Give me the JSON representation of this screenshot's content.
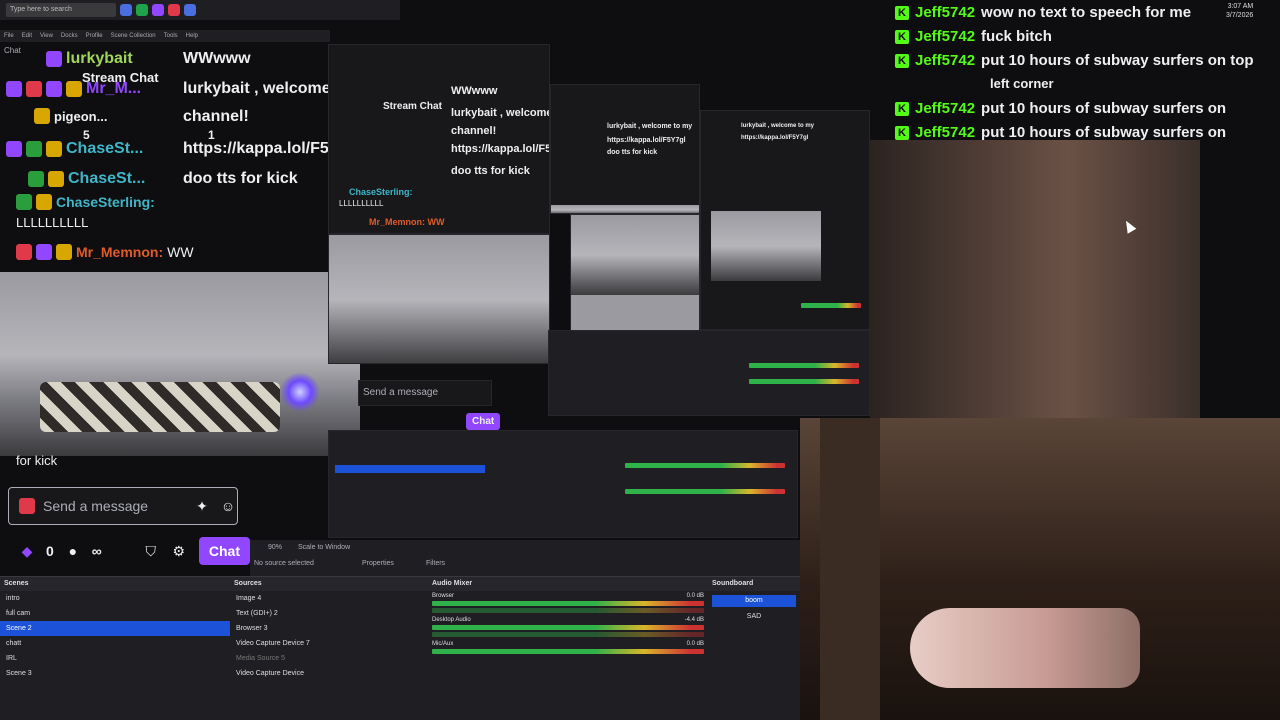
{
  "taskbar": {
    "search_placeholder": "Type here to search"
  },
  "menubar": [
    "File",
    "Edit",
    "View",
    "Docks",
    "Profile",
    "Scene Collection",
    "Tools",
    "Help"
  ],
  "chat_panel": {
    "header": "Chat",
    "stream_title": "Stream Chat",
    "lines": [
      {
        "user": "lurkybait",
        "user_color": "#9fd65a",
        "message": "WWwww"
      },
      {
        "user": "Mr_M...",
        "user_color": "#9147ff",
        "message": "lurkybait , welcome to my"
      },
      {
        "user": "pigeon...",
        "user_color": "#efeff1",
        "message": "channel!"
      },
      {
        "user": "ChaseSt...",
        "user_color": "#3fb6c8",
        "message": "https://kappa.lol/F5Y7gl"
      },
      {
        "user": "ChaseSt...",
        "user_color": "#3fb6c8",
        "message": "doo tts for kick"
      }
    ],
    "full_line_user": "ChaseSterling:",
    "full_line_message": "LLLLLLLLLL",
    "last_user": "Mr_Memnon:",
    "last_message": "WW",
    "counts": {
      "a": "5",
      "b": "1"
    }
  },
  "chat_input": {
    "truncated_prev": "for kick",
    "placeholder": "Send a message",
    "points": "0",
    "viewers_symbol": "∞",
    "chat_button": "Chat"
  },
  "right_chat": [
    {
      "user": "Jeff5742",
      "message": "wow no text to speech for me"
    },
    {
      "user": "Jeff5742",
      "message": "fuck bitch"
    },
    {
      "user": "Jeff5742",
      "message": "put 10 hours of subway surfers on top"
    },
    {
      "user": "",
      "message": "left corner"
    },
    {
      "user": "Jeff5742",
      "message": "put 10 hours of subway surfers on"
    },
    {
      "user": "Jeff5742",
      "message": "put 10 hours of subway surfers on"
    }
  ],
  "clock": {
    "time": "3:07 AM",
    "date": "3/7/2026"
  },
  "obs": {
    "zoom": "90%",
    "scale_label": "Scale to Window",
    "no_source": "No source selected",
    "properties_tab": "Properties",
    "filters_tab": "Filters",
    "scenes": {
      "title": "Scenes",
      "items": [
        "intro",
        "full cam",
        "Scene 2",
        "chatt",
        "IRL",
        "Scene 3"
      ],
      "selected": 2
    },
    "sources": {
      "title": "Sources",
      "items": [
        "Image 4",
        "Text (GDI+) 2",
        "Browser 3",
        "Video Capture Device 7",
        "Media Source 5",
        "Video Capture Device"
      ]
    },
    "mixer": {
      "title": "Audio Mixer",
      "channels": [
        {
          "name": "Browser",
          "db": "0.0 dB"
        },
        {
          "name": "Desktop Audio",
          "db": "-4.4 dB"
        },
        {
          "name": "Mic/Aux",
          "db": "0.0 dB"
        }
      ]
    },
    "soundboard": {
      "title": "Soundboard",
      "buttons": [
        "boom",
        "SAD"
      ]
    }
  },
  "copies": {
    "stream_chat": "Stream Chat",
    "welcome": "lurkybait , welcome to my",
    "channel": "channel!",
    "link": "https://kappa.lol/F5Y7gl",
    "doo": "doo tts for kick",
    "send": "Send a message",
    "chat": "Chat",
    "ww": "Mr_Memnon: WW",
    "lll": "LLLLLLLLLL",
    "chase": "ChaseSterling:",
    "wwwww": "WWwww"
  },
  "colors": {
    "kick_green": "#53fc18",
    "twitch_purple": "#9147ff",
    "obs_select": "#1c52d8"
  }
}
